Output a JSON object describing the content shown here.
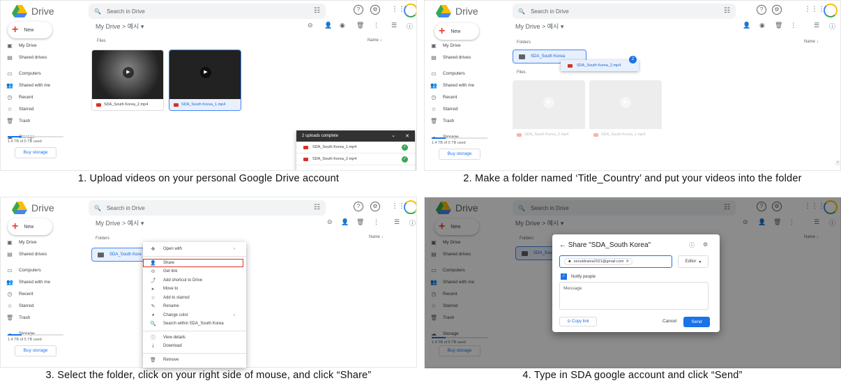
{
  "common": {
    "app_name": "Drive",
    "search_placeholder": "Search in Drive",
    "new_label": "New",
    "sidebar": [
      "My Drive",
      "Shared drives",
      "Computers",
      "Shared with me",
      "Recent",
      "Starred",
      "Trash"
    ],
    "storage_label": "Storage",
    "storage_used": "1.4 TB of 5 TB used",
    "buy_storage": "Buy storage",
    "breadcrumb": "My Drive  >  예시  ▾",
    "name_sort": "Name  ↓",
    "files_label": "Files",
    "folders_label": "Folders"
  },
  "step1": {
    "files": [
      {
        "name": "SDA_South Korea_2.mp4"
      },
      {
        "name": "SDA_South Korea_1.mp4"
      }
    ],
    "uploads": {
      "title": "2 uploads complete",
      "items": [
        "SDA_South Korea_1.mp4",
        "SDA_South Korea_2.mp4"
      ]
    },
    "caption": "1. Upload videos on your personal Google Drive account"
  },
  "step2": {
    "folder_name": "SDA_South Korea",
    "drag_item": "SDA_South Korea_2.mp4",
    "drag_count": "2",
    "ghost_files": [
      "SDA_South Korea_2.mp4",
      "SDA_South Korea_1.mp4"
    ],
    "caption": "2. Make a folder named ‘Title_Country’ and put your videos into the folder"
  },
  "step3": {
    "folder_name": "SDA_South Kore",
    "menu": {
      "open_with": "Open with",
      "share": "Share",
      "get_link": "Get link",
      "add_shortcut": "Add shortcut to Drive",
      "move_to": "Move to",
      "add_starred": "Add to starred",
      "rename": "Rename",
      "change_color": "Change color",
      "search_within": "Search within SDA_South Korea",
      "view_details": "View details",
      "download": "Download",
      "remove": "Remove"
    },
    "caption": "3. Select the folder, click on your right side of mouse, and click “Share”"
  },
  "step4": {
    "dialog_title": "Share \"SDA_South Korea\"",
    "email_chip": "seouldrama2021@gmail.com",
    "role": "Editor",
    "notify": "Notify people",
    "message_placeholder": "Message",
    "copy_link": "Copy link",
    "cancel": "Cancel",
    "send": "Send",
    "folder_name": "SDA_South",
    "caption": "4. Type in SDA google account and click “Send”"
  }
}
